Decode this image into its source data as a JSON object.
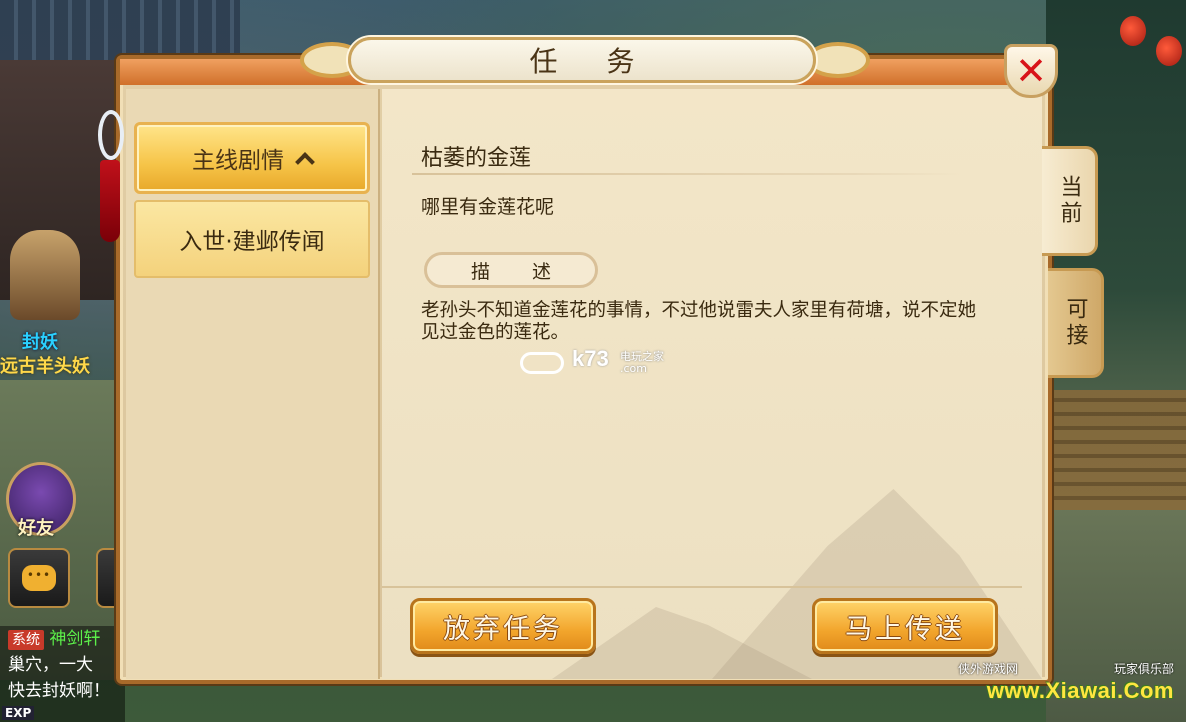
{
  "panel": {
    "title": "任 务"
  },
  "categories": {
    "main_label": "主线剧情",
    "sub_label": "入世·建邺传闻"
  },
  "tabs": {
    "current": "当前",
    "available": "可接"
  },
  "quest": {
    "title": "枯萎的金莲",
    "objective": "哪里有金莲花呢",
    "description_header": "描 述",
    "description": "老孙头不知道金莲花的事情，不过他说雷夫人家里有荷塘，说不定她见过金色的莲花。"
  },
  "buttons": {
    "abandon": "放弃任务",
    "teleport": "马上传送"
  },
  "background_hud": {
    "npc_tag": "封妖",
    "npc_name": "远古羊头妖",
    "friend_label": "好友",
    "chat_system_tag": "系统",
    "chat_line1": "神剑轩",
    "chat_line2": "巢穴，一大",
    "chat_line3": "快去封妖啊！",
    "exp_label": "EXP"
  },
  "watermarks": {
    "k73": "k73",
    "k73_sub": "电玩之家",
    "k73_domain": ".com",
    "site_left": "侠外游戏网",
    "site_right": "玩家俱乐部",
    "site_url": "www.Xiawai.Com"
  },
  "colors": {
    "panel_border": "#a86a2a",
    "button_gold": "#f2a52c",
    "close_red": "#d8141a",
    "category_gold": "#f6c448"
  }
}
